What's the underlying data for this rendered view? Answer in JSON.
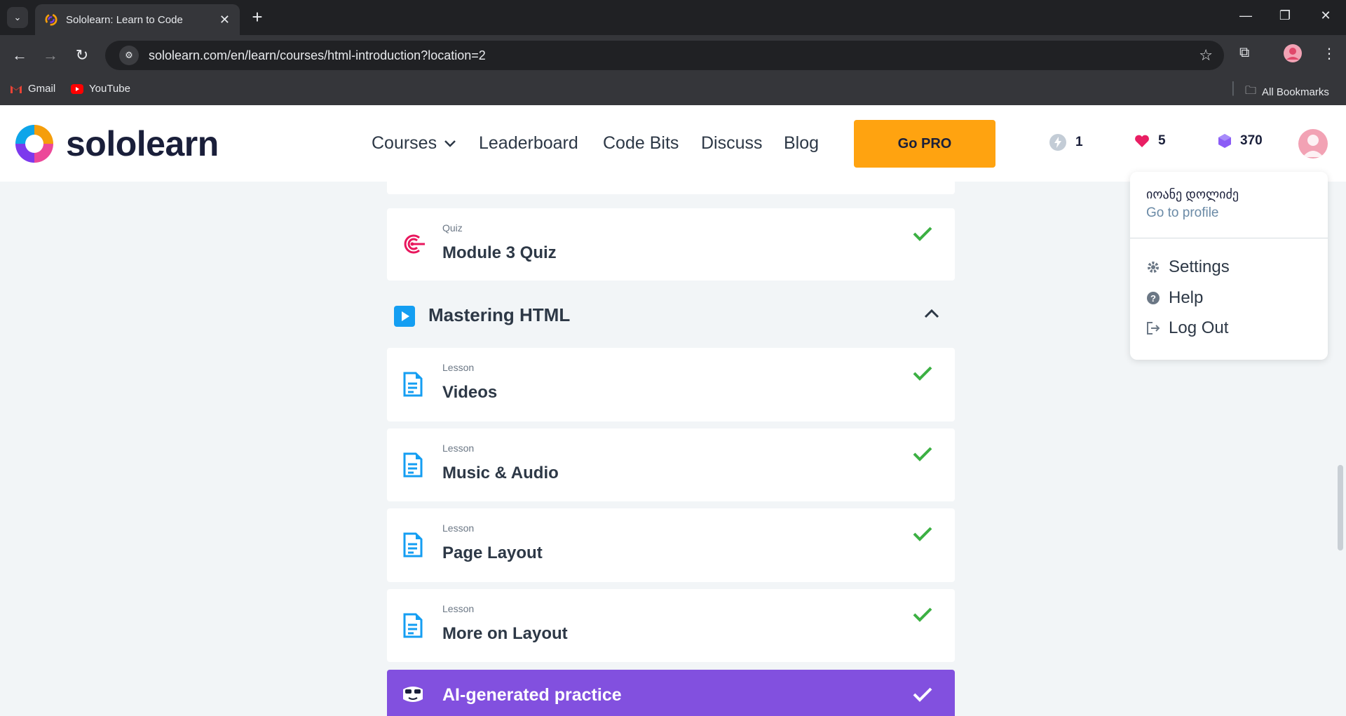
{
  "browser": {
    "tab_title": "Sololearn: Learn to Code",
    "url": "sololearn.com/en/learn/courses/html-introduction?location=2",
    "bookmarks": [
      {
        "label": "Gmail"
      },
      {
        "label": "YouTube"
      }
    ],
    "all_bookmarks": "All Bookmarks"
  },
  "header": {
    "logo_text": "sololearn",
    "nav": [
      "Courses",
      "Leaderboard",
      "Code Bits",
      "Discuss",
      "Blog"
    ],
    "go_pro": "Go PRO",
    "streak": "1",
    "hearts": "5",
    "bits": "370",
    "colors": {
      "accent": "#ffa310",
      "brand_dark": "#1a1f3a"
    }
  },
  "content": {
    "quiz": {
      "type": "Quiz",
      "title": "Module 3 Quiz",
      "completed": true
    },
    "section": {
      "title": "Mastering HTML",
      "expanded": true
    },
    "lessons": [
      {
        "type": "Lesson",
        "title": "Videos",
        "completed": true
      },
      {
        "type": "Lesson",
        "title": "Music & Audio",
        "completed": true
      },
      {
        "type": "Lesson",
        "title": "Page Layout",
        "completed": true
      },
      {
        "type": "Lesson",
        "title": "More on Layout",
        "completed": true
      }
    ],
    "ai_practice": {
      "title": "AI-generated practice",
      "completed": true,
      "color": "#8250df"
    }
  },
  "profile_menu": {
    "user_name": "იოანე დოლიძე",
    "go_to_profile": "Go to profile",
    "items": [
      "Settings",
      "Help",
      "Log Out"
    ]
  }
}
